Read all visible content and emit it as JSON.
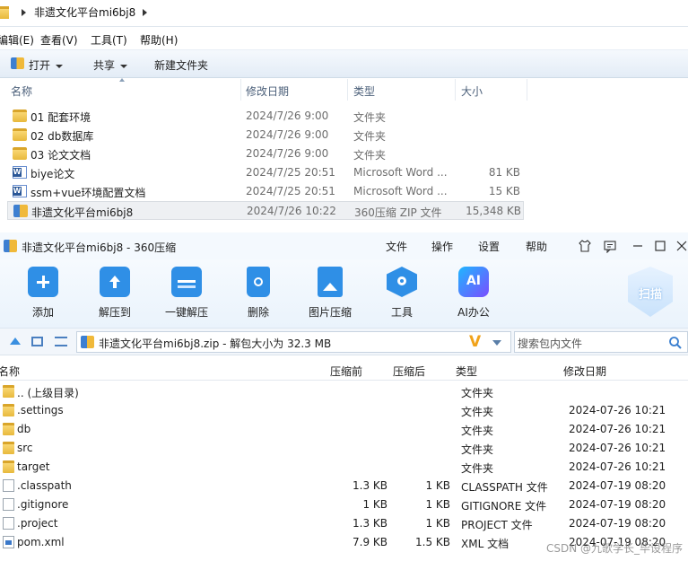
{
  "explorer": {
    "path": "非遗文化平台mi6bj8",
    "menu": [
      "编辑(E)",
      "查看(V)",
      "工具(T)",
      "帮助(H)"
    ],
    "toolbar": {
      "open": "打开",
      "share": "共享",
      "new_folder": "新建文件夹"
    },
    "columns": {
      "name": "名称",
      "date": "修改日期",
      "type": "类型",
      "size": "大小"
    },
    "files": [
      {
        "name": "01 配套环境",
        "date": "2024/7/26 9:00",
        "type": "文件夹",
        "size": "",
        "icon": "folder-icon"
      },
      {
        "name": "02 db数据库",
        "date": "2024/7/26 9:00",
        "type": "文件夹",
        "size": "",
        "icon": "folder-icon"
      },
      {
        "name": "03 论文文档",
        "date": "2024/7/26 9:00",
        "type": "文件夹",
        "size": "",
        "icon": "folder-icon"
      },
      {
        "name": "biye论文",
        "date": "2024/7/25 20:51",
        "type": "Microsoft Word ...",
        "size": "81 KB",
        "icon": "word-icon"
      },
      {
        "name": "ssm+vue环境配置文档",
        "date": "2024/7/25 20:51",
        "type": "Microsoft Word ...",
        "size": "15 KB",
        "icon": "word-icon"
      },
      {
        "name": "非遗文化平台mi6bj8",
        "date": "2024/7/26 10:22",
        "type": "360压缩 ZIP 文件",
        "size": "15,348 KB",
        "icon": "zip-icon"
      }
    ]
  },
  "zip": {
    "title": "非遗文化平台mi6bj8 - 360压缩",
    "menu": [
      "文件",
      "操作",
      "设置",
      "帮助"
    ],
    "ribbon": [
      "添加",
      "解压到",
      "一键解压",
      "删除",
      "图片压缩",
      "工具",
      "AI办公"
    ],
    "scan_label": "扫描",
    "ai_icon_text": "AI",
    "path_text": "非遗文化平台mi6bj8.zip - 解包大小为 32.3 MB",
    "search_placeholder": "搜索包内文件",
    "columns": {
      "name": "名称",
      "compressed_before": "压缩前",
      "compressed_after": "压缩后",
      "type": "类型",
      "date": "修改日期"
    },
    "files": [
      {
        "name": ".. (上级目录)",
        "before": "",
        "after": "",
        "type": "文件夹",
        "date": "",
        "icon": "folder-icon"
      },
      {
        "name": ".settings",
        "before": "",
        "after": "",
        "type": "文件夹",
        "date": "2024-07-26 10:21",
        "icon": "folder-icon"
      },
      {
        "name": "db",
        "before": "",
        "after": "",
        "type": "文件夹",
        "date": "2024-07-26 10:21",
        "icon": "folder-icon"
      },
      {
        "name": "src",
        "before": "",
        "after": "",
        "type": "文件夹",
        "date": "2024-07-26 10:21",
        "icon": "folder-icon"
      },
      {
        "name": "target",
        "before": "",
        "after": "",
        "type": "文件夹",
        "date": "2024-07-26 10:21",
        "icon": "folder-icon"
      },
      {
        "name": ".classpath",
        "before": "1.3 KB",
        "after": "1 KB",
        "type": "CLASSPATH 文件",
        "date": "2024-07-19 08:20",
        "icon": "file-icon"
      },
      {
        "name": ".gitignore",
        "before": "1 KB",
        "after": "1 KB",
        "type": "GITIGNORE 文件",
        "date": "2024-07-19 08:20",
        "icon": "file-icon"
      },
      {
        "name": ".project",
        "before": "1.3 KB",
        "after": "1 KB",
        "type": "PROJECT 文件",
        "date": "2024-07-19 08:20",
        "icon": "file-icon"
      },
      {
        "name": "pom.xml",
        "before": "7.9 KB",
        "after": "1.5 KB",
        "type": "XML 文档",
        "date": "2024-07-19 08:20",
        "icon": "xml-file-icon"
      }
    ]
  },
  "watermark": "CSDN @九歌学长_毕设程序"
}
